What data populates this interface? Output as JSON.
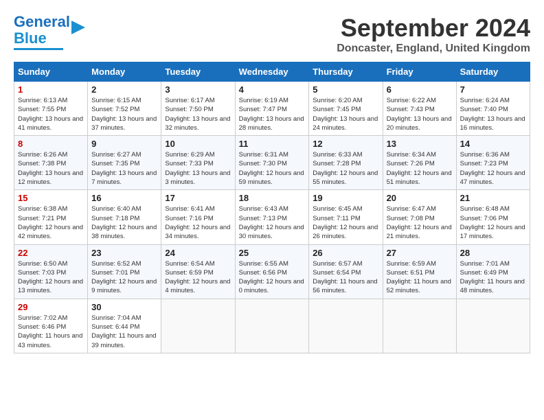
{
  "header": {
    "logo_line1": "General",
    "logo_line2": "Blue",
    "title": "September 2024",
    "subtitle": "Doncaster, England, United Kingdom"
  },
  "calendar": {
    "headers": [
      "Sunday",
      "Monday",
      "Tuesday",
      "Wednesday",
      "Thursday",
      "Friday",
      "Saturday"
    ],
    "weeks": [
      [
        null,
        {
          "day": "2",
          "sunrise": "Sunrise: 6:15 AM",
          "sunset": "Sunset: 7:52 PM",
          "daylight": "Daylight: 13 hours and 37 minutes."
        },
        {
          "day": "3",
          "sunrise": "Sunrise: 6:17 AM",
          "sunset": "Sunset: 7:50 PM",
          "daylight": "Daylight: 13 hours and 32 minutes."
        },
        {
          "day": "4",
          "sunrise": "Sunrise: 6:19 AM",
          "sunset": "Sunset: 7:47 PM",
          "daylight": "Daylight: 13 hours and 28 minutes."
        },
        {
          "day": "5",
          "sunrise": "Sunrise: 6:20 AM",
          "sunset": "Sunset: 7:45 PM",
          "daylight": "Daylight: 13 hours and 24 minutes."
        },
        {
          "day": "6",
          "sunrise": "Sunrise: 6:22 AM",
          "sunset": "Sunset: 7:43 PM",
          "daylight": "Daylight: 13 hours and 20 minutes."
        },
        {
          "day": "7",
          "sunrise": "Sunrise: 6:24 AM",
          "sunset": "Sunset: 7:40 PM",
          "daylight": "Daylight: 13 hours and 16 minutes."
        }
      ],
      [
        {
          "day": "1",
          "sunrise": "Sunrise: 6:13 AM",
          "sunset": "Sunset: 7:55 PM",
          "daylight": "Daylight: 13 hours and 41 minutes."
        },
        {
          "day": "9",
          "sunrise": "Sunrise: 6:27 AM",
          "sunset": "Sunset: 7:35 PM",
          "daylight": "Daylight: 13 hours and 7 minutes."
        },
        {
          "day": "10",
          "sunrise": "Sunrise: 6:29 AM",
          "sunset": "Sunset: 7:33 PM",
          "daylight": "Daylight: 13 hours and 3 minutes."
        },
        {
          "day": "11",
          "sunrise": "Sunrise: 6:31 AM",
          "sunset": "Sunset: 7:30 PM",
          "daylight": "Daylight: 12 hours and 59 minutes."
        },
        {
          "day": "12",
          "sunrise": "Sunrise: 6:33 AM",
          "sunset": "Sunset: 7:28 PM",
          "daylight": "Daylight: 12 hours and 55 minutes."
        },
        {
          "day": "13",
          "sunrise": "Sunrise: 6:34 AM",
          "sunset": "Sunset: 7:26 PM",
          "daylight": "Daylight: 12 hours and 51 minutes."
        },
        {
          "day": "14",
          "sunrise": "Sunrise: 6:36 AM",
          "sunset": "Sunset: 7:23 PM",
          "daylight": "Daylight: 12 hours and 47 minutes."
        }
      ],
      [
        {
          "day": "8",
          "sunrise": "Sunrise: 6:26 AM",
          "sunset": "Sunset: 7:38 PM",
          "daylight": "Daylight: 13 hours and 12 minutes."
        },
        {
          "day": "16",
          "sunrise": "Sunrise: 6:40 AM",
          "sunset": "Sunset: 7:18 PM",
          "daylight": "Daylight: 12 hours and 38 minutes."
        },
        {
          "day": "17",
          "sunrise": "Sunrise: 6:41 AM",
          "sunset": "Sunset: 7:16 PM",
          "daylight": "Daylight: 12 hours and 34 minutes."
        },
        {
          "day": "18",
          "sunrise": "Sunrise: 6:43 AM",
          "sunset": "Sunset: 7:13 PM",
          "daylight": "Daylight: 12 hours and 30 minutes."
        },
        {
          "day": "19",
          "sunrise": "Sunrise: 6:45 AM",
          "sunset": "Sunset: 7:11 PM",
          "daylight": "Daylight: 12 hours and 26 minutes."
        },
        {
          "day": "20",
          "sunrise": "Sunrise: 6:47 AM",
          "sunset": "Sunset: 7:08 PM",
          "daylight": "Daylight: 12 hours and 21 minutes."
        },
        {
          "day": "21",
          "sunrise": "Sunrise: 6:48 AM",
          "sunset": "Sunset: 7:06 PM",
          "daylight": "Daylight: 12 hours and 17 minutes."
        }
      ],
      [
        {
          "day": "15",
          "sunrise": "Sunrise: 6:38 AM",
          "sunset": "Sunset: 7:21 PM",
          "daylight": "Daylight: 12 hours and 42 minutes."
        },
        {
          "day": "23",
          "sunrise": "Sunrise: 6:52 AM",
          "sunset": "Sunset: 7:01 PM",
          "daylight": "Daylight: 12 hours and 9 minutes."
        },
        {
          "day": "24",
          "sunrise": "Sunrise: 6:54 AM",
          "sunset": "Sunset: 6:59 PM",
          "daylight": "Daylight: 12 hours and 4 minutes."
        },
        {
          "day": "25",
          "sunrise": "Sunrise: 6:55 AM",
          "sunset": "Sunset: 6:56 PM",
          "daylight": "Daylight: 12 hours and 0 minutes."
        },
        {
          "day": "26",
          "sunrise": "Sunrise: 6:57 AM",
          "sunset": "Sunset: 6:54 PM",
          "daylight": "Daylight: 11 hours and 56 minutes."
        },
        {
          "day": "27",
          "sunrise": "Sunrise: 6:59 AM",
          "sunset": "Sunset: 6:51 PM",
          "daylight": "Daylight: 11 hours and 52 minutes."
        },
        {
          "day": "28",
          "sunrise": "Sunrise: 7:01 AM",
          "sunset": "Sunset: 6:49 PM",
          "daylight": "Daylight: 11 hours and 48 minutes."
        }
      ],
      [
        {
          "day": "22",
          "sunrise": "Sunrise: 6:50 AM",
          "sunset": "Sunset: 7:03 PM",
          "daylight": "Daylight: 12 hours and 13 minutes."
        },
        {
          "day": "30",
          "sunrise": "Sunrise: 7:04 AM",
          "sunset": "Sunset: 6:44 PM",
          "daylight": "Daylight: 11 hours and 39 minutes."
        },
        null,
        null,
        null,
        null,
        null
      ],
      [
        {
          "day": "29",
          "sunrise": "Sunrise: 7:02 AM",
          "sunset": "Sunset: 6:46 PM",
          "daylight": "Daylight: 11 hours and 43 minutes."
        },
        null,
        null,
        null,
        null,
        null,
        null
      ]
    ]
  }
}
